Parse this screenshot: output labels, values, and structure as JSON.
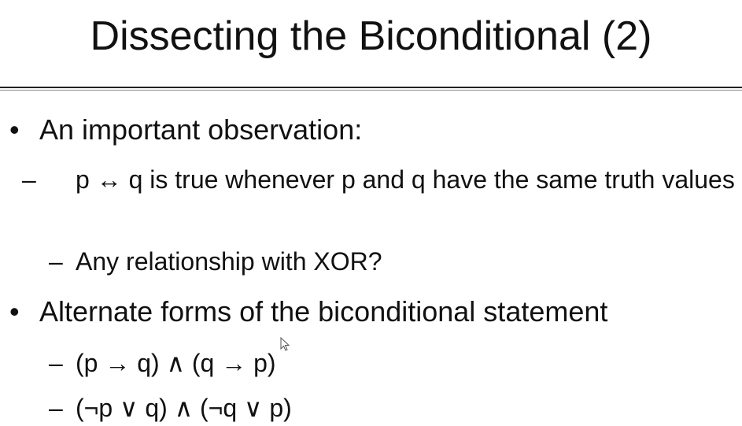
{
  "slide": {
    "title": "Dissecting the Biconditional (2)",
    "bullets": [
      {
        "marker": "•",
        "text": "An important observation:",
        "subitems": [
          {
            "marker": "–",
            "text": "p ↔ q is true whenever p and q have the same truth values"
          },
          {
            "marker": "–",
            "text": "Any relationship with XOR?"
          }
        ]
      },
      {
        "marker": "•",
        "text": "Alternate forms of the biconditional statement",
        "subitems": [
          {
            "marker": "–",
            "text": "(p → q) ∧ (q → p)"
          },
          {
            "marker": "–",
            "text": "(¬p ∨ q) ∧ (¬q ∨ p)"
          }
        ]
      }
    ]
  },
  "icons": {
    "cursor": "mouse-pointer-icon"
  }
}
